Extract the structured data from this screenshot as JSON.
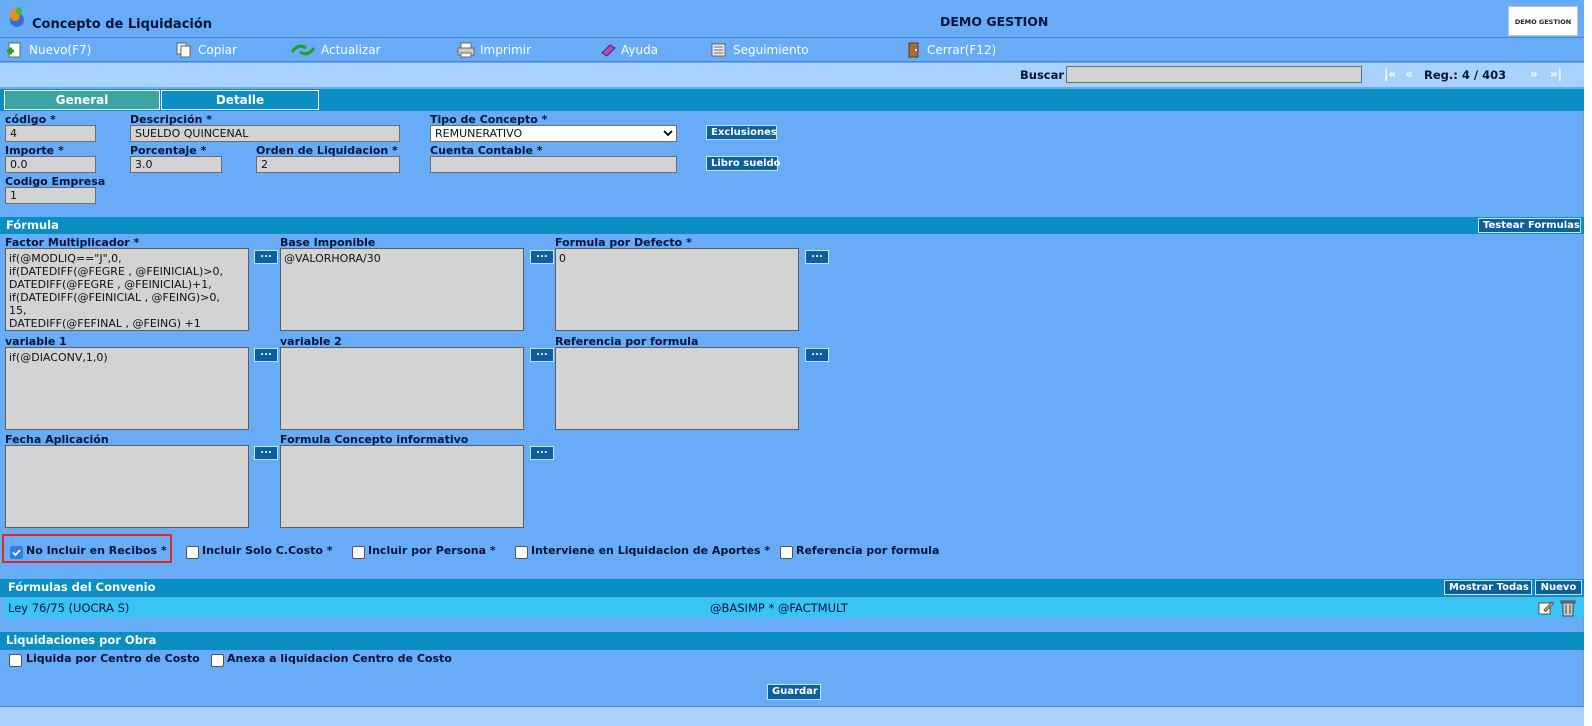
{
  "window": {
    "title": "Concepto de Liquidación",
    "company": "DEMO GESTION",
    "brand": "DEMO GESTION"
  },
  "toolbar": {
    "nuevo": "Nuevo(F7)",
    "copiar": "Copiar",
    "actualizar": "Actualizar",
    "imprimir": "Imprimir",
    "ayuda": "Ayuda",
    "seguimiento": "Seguimiento",
    "cerrar": "Cerrar(F12)"
  },
  "search": {
    "label": "Buscar",
    "value": ""
  },
  "nav": {
    "first": "|«",
    "prev": "«",
    "reg": "Reg.: 4 / 403",
    "next": "»",
    "last": "»|"
  },
  "tabs": [
    {
      "label": "General"
    },
    {
      "label": "Detalle"
    }
  ],
  "form": {
    "codigo_label": "código *",
    "codigo_value": "4",
    "descripcion_label": "Descripción *",
    "descripcion_value": "SUELDO QUINCENAL",
    "tipo_label": "Tipo de Concepto *",
    "tipo_value": "REMUNERATIVO",
    "exclusiones_btn": "Exclusiones",
    "importe_label": "Importe *",
    "importe_value": "0.0",
    "porcentaje_label": "Porcentaje *",
    "porcentaje_value": "3.0",
    "orden_label": "Orden de Liquidacion *",
    "orden_value": "2",
    "cuenta_label": "Cuenta Contable *",
    "cuenta_value": "",
    "libro_btn": "Libro sueldo",
    "empresa_label": "Codigo Empresa",
    "empresa_value": "1"
  },
  "formula": {
    "title": "Fórmula",
    "test_btn": "Testear Formulas",
    "factor_label": "Factor Multiplicador *",
    "factor_value": "if(@MODLIQ==\"J\",0,\nif(DATEDIFF(@FEGRE , @FEINICIAL)>0,\nDATEDIFF(@FEGRE , @FEINICIAL)+1,\nif(DATEDIFF(@FEINICIAL , @FEING)>0,\n15,\nDATEDIFF(@FEFINAL , @FEING) +1",
    "base_label": "Base Imponible",
    "base_value": "@VALORHORA/30",
    "defecto_label": "Formula por Defecto *",
    "defecto_value": "0",
    "var1_label": "variable 1",
    "var1_value": "if(@DIACONV,1,0)",
    "var2_label": "variable 2",
    "var2_value": "",
    "ref_label": "Referencia por formula",
    "ref_value": "",
    "fecha_label": "Fecha Aplicación",
    "fecha_value": "",
    "informativo_label": "Formula Concepto informativo",
    "informativo_value": "",
    "dots": "..."
  },
  "checks": {
    "no_incluir": {
      "label": "No Incluir en Recibos *",
      "checked": true
    },
    "solo_costo": {
      "label": "Incluir Solo C.Costo *",
      "checked": false
    },
    "por_persona": {
      "label": "Incluir por Persona *",
      "checked": false
    },
    "aportes": {
      "label": "Interviene en Liquidacion de Aportes *",
      "checked": false
    },
    "referencia": {
      "label": "Referencia por formula",
      "checked": false
    }
  },
  "convenio": {
    "title": "Fórmulas del Convenio",
    "mostrar_btn": "Mostrar Todas",
    "nuevo_btn": "Nuevo",
    "rows": [
      {
        "name": "Ley 76/75 (UOCRA S)",
        "formula": "@BASIMP * @FACTMULT"
      }
    ]
  },
  "obra": {
    "title": "Liquidaciones por Obra",
    "centro_label": "Liquida por Centro de Costo",
    "centro_checked": false,
    "anexa_label": "Anexa a liquidacion Centro de Costo",
    "anexa_checked": false
  },
  "guardar_btn": "Guardar",
  "colors": {
    "frame": "#68acf7",
    "section": "#0b8ec3",
    "button": "#0a5f9e",
    "row": "#39c4f4",
    "highlight": "#e8261f"
  }
}
